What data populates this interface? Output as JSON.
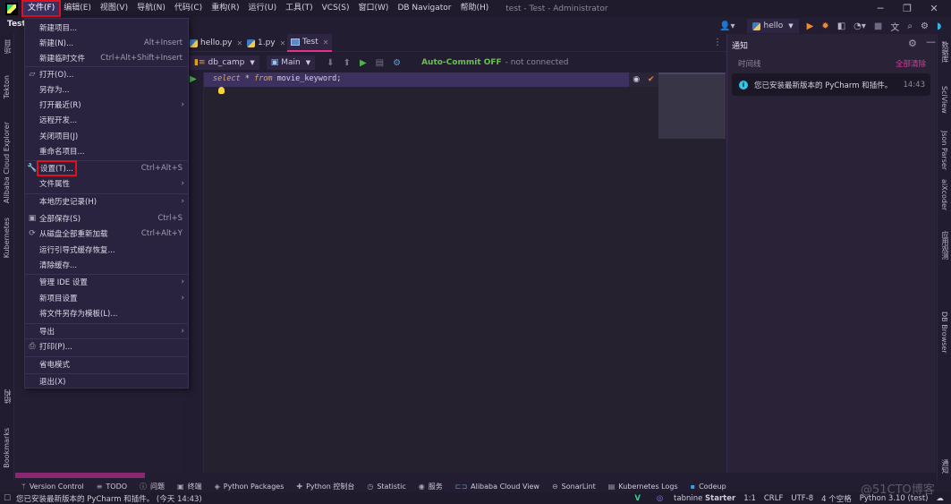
{
  "window": {
    "title": "test - Test - Administrator",
    "controls": [
      "minimize",
      "restore",
      "close"
    ]
  },
  "menubar": {
    "items": [
      "文件(F)",
      "编辑(E)",
      "视图(V)",
      "导航(N)",
      "代码(C)",
      "重构(R)",
      "运行(U)",
      "工具(T)",
      "VCS(S)",
      "窗口(W)",
      "DB Navigator",
      "帮助(H)"
    ],
    "active_index": 0
  },
  "project": {
    "name": "Test"
  },
  "file_menu": {
    "items": [
      {
        "label": "新建项目...",
        "shortcut": "",
        "submenu": false,
        "icon": ""
      },
      {
        "label": "新建(N)...",
        "shortcut": "Alt+Insert",
        "submenu": false,
        "icon": ""
      },
      {
        "label": "新建临时文件",
        "shortcut": "Ctrl+Alt+Shift+Insert",
        "submenu": false,
        "icon": ""
      },
      {
        "label": "打开(O)...",
        "shortcut": "",
        "submenu": false,
        "icon": "folder-open-icon"
      },
      {
        "label": "另存为...",
        "shortcut": "",
        "submenu": false,
        "icon": ""
      },
      {
        "label": "打开最近(R)",
        "shortcut": "",
        "submenu": true,
        "icon": ""
      },
      {
        "label": "远程开发...",
        "shortcut": "",
        "submenu": false,
        "icon": ""
      },
      {
        "label": "关闭项目(J)",
        "shortcut": "",
        "submenu": false,
        "icon": ""
      },
      {
        "label": "重命名项目...",
        "shortcut": "",
        "submenu": false,
        "icon": ""
      },
      {
        "label": "设置(T)...",
        "shortcut": "Ctrl+Alt+S",
        "submenu": false,
        "icon": "wrench-icon",
        "highlighted": true
      },
      {
        "label": "文件属性",
        "shortcut": "",
        "submenu": true,
        "icon": ""
      },
      {
        "label": "本地历史记录(H)",
        "shortcut": "",
        "submenu": true,
        "icon": ""
      },
      {
        "label": "全部保存(S)",
        "shortcut": "Ctrl+S",
        "submenu": false,
        "icon": "save-icon"
      },
      {
        "label": "从磁盘全部重新加载",
        "shortcut": "Ctrl+Alt+Y",
        "submenu": false,
        "icon": "reload-icon"
      },
      {
        "label": "运行引导式缓存恢复...",
        "shortcut": "",
        "submenu": false,
        "icon": ""
      },
      {
        "label": "清除缓存...",
        "shortcut": "",
        "submenu": false,
        "icon": ""
      },
      {
        "label": "管理 IDE 设置",
        "shortcut": "",
        "submenu": true,
        "icon": ""
      },
      {
        "label": "新项目设置",
        "shortcut": "",
        "submenu": true,
        "icon": ""
      },
      {
        "label": "将文件另存为模板(L)...",
        "shortcut": "",
        "submenu": false,
        "icon": ""
      },
      {
        "label": "导出",
        "shortcut": "",
        "submenu": true,
        "icon": ""
      },
      {
        "label": "打印(P)...",
        "shortcut": "",
        "submenu": false,
        "icon": "print-icon"
      },
      {
        "label": "省电模式",
        "shortcut": "",
        "submenu": false,
        "icon": ""
      },
      {
        "label": "退出(X)",
        "shortcut": "",
        "submenu": false,
        "icon": ""
      }
    ]
  },
  "left_stripe": [
    "项目",
    "Tekton",
    "Alibaba Cloud Explorer",
    "Kubernetes",
    "结构",
    "Bookmarks"
  ],
  "right_stripe": [
    "数据库",
    "SciView",
    "Json Parser",
    "aiXcoder",
    "应用观测",
    "DB Browser",
    "通知"
  ],
  "toolbar": {
    "run_config": "hello"
  },
  "tabs": [
    {
      "label": "hello.py",
      "active": false,
      "icon": "python-file-icon"
    },
    {
      "label": "1.py",
      "active": false,
      "icon": "python-file-icon"
    },
    {
      "label": "Test",
      "active": true,
      "icon": "console-icon"
    }
  ],
  "db_toolbar": {
    "connection": "db_camp",
    "schema": "Main",
    "auto_commit": "Auto-Commit OFF",
    "status": "- not connected"
  },
  "editor": {
    "code": {
      "kw1": "select",
      "op": " * ",
      "kw2": "from",
      "rest": " movie_keyword;"
    }
  },
  "notifications": {
    "title": "通知",
    "timeline_label": "时间线",
    "clear_all": "全部清除",
    "items": [
      {
        "message": "您已安装最新版本的 PyCharm 和插件。",
        "time": "14:43"
      }
    ]
  },
  "tool_tabs": [
    {
      "label": "Version Control",
      "icon": "vcs-icon"
    },
    {
      "label": "TODO",
      "icon": "list-icon"
    },
    {
      "label": "问题",
      "icon": "problems-icon"
    },
    {
      "label": "终端",
      "icon": "terminal-icon"
    },
    {
      "label": "Python Packages",
      "icon": "packages-icon"
    },
    {
      "label": "Python 控制台",
      "icon": "python-console-icon"
    },
    {
      "label": "Statistic",
      "icon": "statistic-icon"
    },
    {
      "label": "服务",
      "icon": "services-icon"
    },
    {
      "label": "Alibaba Cloud View",
      "icon": "alibaba-icon"
    },
    {
      "label": "SonarLint",
      "icon": "sonarlint-icon"
    },
    {
      "label": "Kubernetes Logs",
      "icon": "logs-icon"
    },
    {
      "label": "Codeup",
      "icon": "codeup-icon"
    }
  ],
  "statusbar": {
    "message": "您已安装最新版本的 PyCharm 和插件。 (今天 14:43)",
    "tabnine": "tabnine",
    "tabnine_plan": "Starter",
    "position": "1:1",
    "line_sep": "CRLF",
    "encoding": "UTF-8",
    "indent": "4 个空格",
    "interpreter": "Python 3.10 (test)"
  },
  "watermark": "@51CTO博客",
  "colors": {
    "accent_pink": "#e6308a",
    "highlight_red": "#e01020",
    "auto_commit_green": "#6bc04b",
    "info_cyan": "#30c8e6"
  }
}
